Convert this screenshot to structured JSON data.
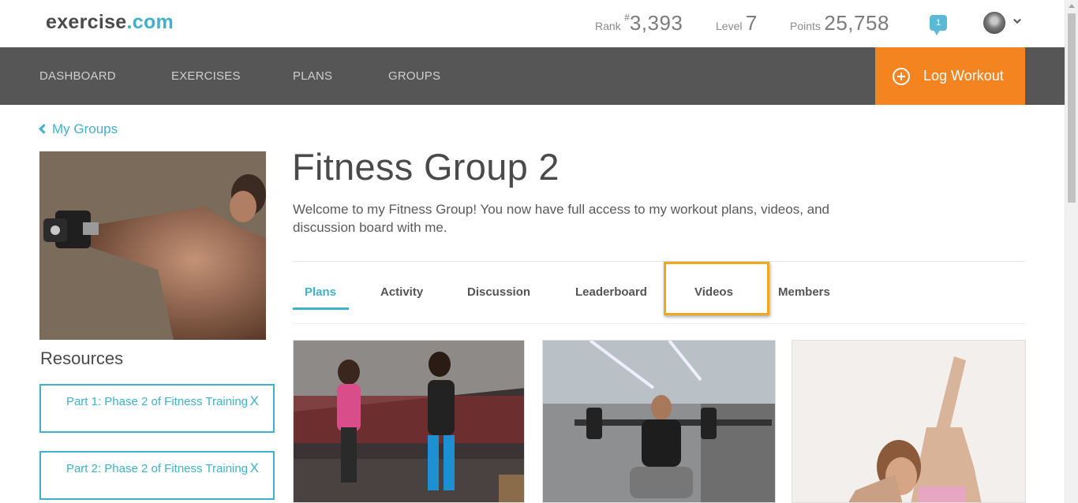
{
  "header": {
    "logo_main": "exercise",
    "logo_dot": ".com",
    "rank_label": "Rank",
    "rank_hash": "#",
    "rank_value": "3,393",
    "level_label": "Level",
    "level_value": "7",
    "points_label": "Points",
    "points_value": "25,758",
    "notification_count": "1"
  },
  "nav": {
    "items": [
      "DASHBOARD",
      "EXERCISES",
      "PLANS",
      "GROUPS"
    ],
    "log_workout": "Log Workout"
  },
  "back_link": "My Groups",
  "group": {
    "title": "Fitness Group 2",
    "description": "Welcome to my Fitness Group! You now have full access to my workout plans, videos, and discussion board with me."
  },
  "resources": {
    "title": "Resources",
    "items": [
      {
        "label": "Part 1: Phase 2 of Fitness Training",
        "remove": "X"
      },
      {
        "label": "Part 2: Phase 2 of Fitness Training",
        "remove": "X"
      }
    ]
  },
  "tabs": [
    "Plans",
    "Activity",
    "Discussion",
    "Leaderboard",
    "Videos",
    "Members"
  ],
  "active_tab": "Plans",
  "colors": {
    "accent": "#3fb1c8",
    "nav_bg": "#565656",
    "cta": "#f4841f",
    "highlight": "#f0a81e"
  },
  "icons": {
    "back": "chevron-left-icon",
    "notification": "speech-bubble-icon",
    "log_workout": "plus-circle-icon",
    "avatar_menu": "chevron-down-icon"
  }
}
